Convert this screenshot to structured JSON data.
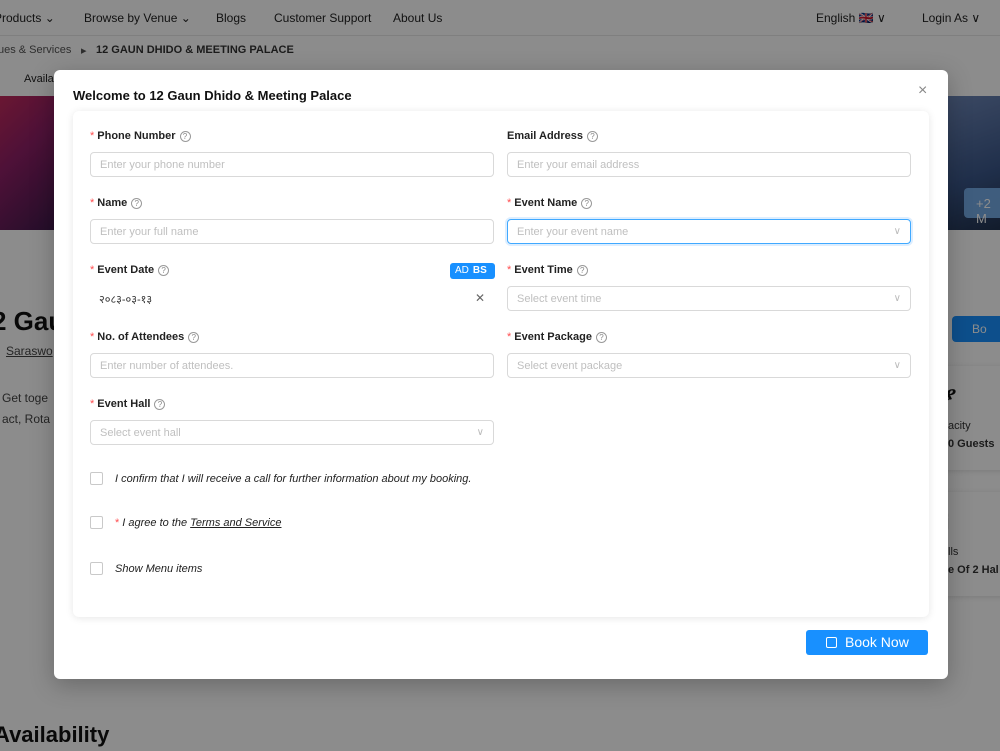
{
  "nav": {
    "products": "Products ⌄",
    "browse": "Browse by Venue ⌄",
    "blogs": "Blogs",
    "support": "Customer Support",
    "about": "About Us",
    "language": "English 🇬🇧 ∨",
    "login": "Login As ∨"
  },
  "breadcrumb": {
    "parent": "ues & Services",
    "separator": "▸",
    "current": "12 GAUN DHIDO & MEETING PALACE"
  },
  "background": {
    "avail_tab": "Availa",
    "more_photos": "+2 M",
    "venue_title": "2 Gau",
    "venue_location": "Saraswo",
    "desc_line1": "Get toge",
    "desc_line2": "act, Rota",
    "book_button": "Bo",
    "card1_icon": "ያ",
    "card1_label": "acity",
    "card1_value": "0 Guests",
    "card2_icon": "ⅰ",
    "card2_label": "lls",
    "card2_value": "e Of 2 Hal",
    "availability_heading": "Availability"
  },
  "modal": {
    "title": "Welcome to 12 Gaun Dhido & Meeting Palace",
    "close": "×",
    "phone": {
      "label": "Phone Number",
      "placeholder": "Enter your phone number"
    },
    "email": {
      "label": "Email Address",
      "placeholder": "Enter your email address"
    },
    "name": {
      "label": "Name",
      "placeholder": "Enter your full name"
    },
    "event_name": {
      "label": "Event Name",
      "placeholder": "Enter your event name"
    },
    "event_date": {
      "label": "Event Date",
      "value": "२०८३-०३-१३",
      "toggle_ad": "AD",
      "toggle_bs": "BS"
    },
    "event_time": {
      "label": "Event Time",
      "placeholder": "Select event time"
    },
    "attendees": {
      "label": "No. of Attendees",
      "placeholder": "Enter number of attendees."
    },
    "event_package": {
      "label": "Event Package",
      "placeholder": "Select event package"
    },
    "event_hall": {
      "label": "Event Hall",
      "placeholder": "Select event hall"
    },
    "confirm_call": "I confirm that I will receive a call for further information about my booking.",
    "agree_prefix": "I agree to the ",
    "terms_link": "Terms and Service",
    "show_menu": "Show Menu items",
    "book_now": "Book Now"
  }
}
